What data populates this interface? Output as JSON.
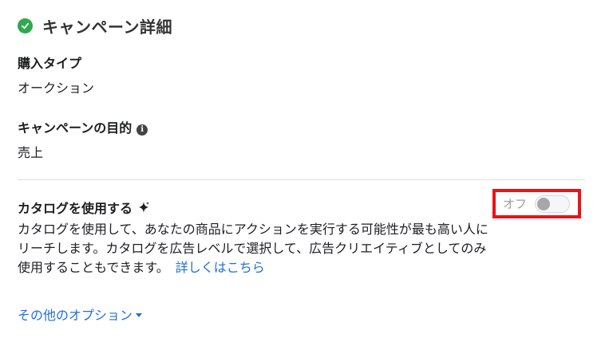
{
  "header": {
    "title": "キャンペーン詳細"
  },
  "purchase_type": {
    "label": "購入タイプ",
    "value": "オークション"
  },
  "objective": {
    "label": "キャンペーンの目的",
    "value": "売上"
  },
  "catalog": {
    "title": "カタログを使用する",
    "description": "カタログを使用して、あなたの商品にアクションを実行する可能性が最も高い人にリーチします。カタログを広告レベルで選択して、広告クリエイティブとしてのみ使用することもできます。",
    "link_label": "詳しくはこちら",
    "toggle_label": "オフ",
    "toggle_state": "off"
  },
  "more_options": {
    "label": "その他のオプション"
  },
  "colors": {
    "accent": "#216fdb",
    "success": "#2fa84f",
    "highlight_box": "#e8131b"
  }
}
